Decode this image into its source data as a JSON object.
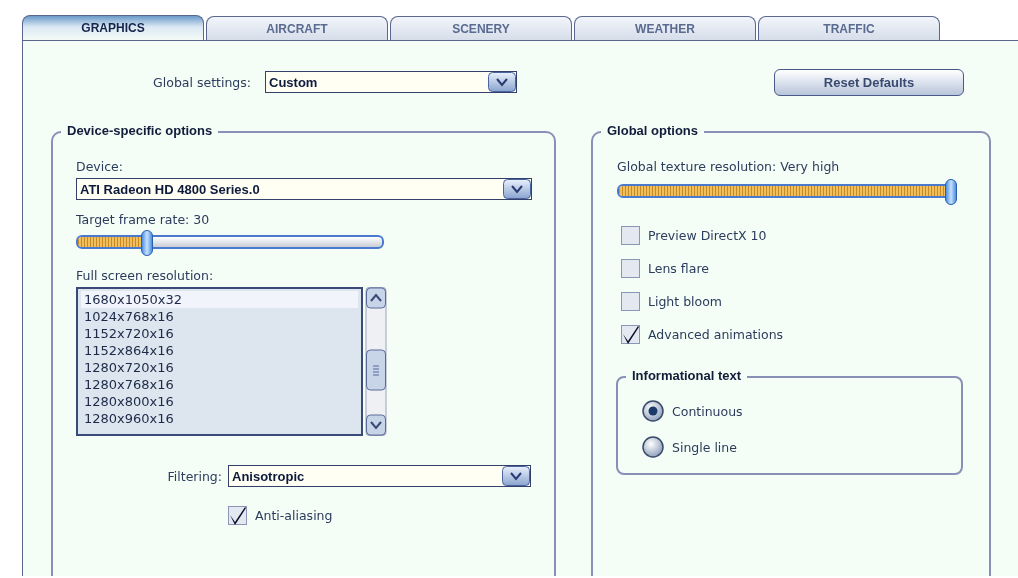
{
  "tabs": [
    {
      "label": "GRAPHICS",
      "selected": true
    },
    {
      "label": "AIRCRAFT",
      "selected": false
    },
    {
      "label": "SCENERY",
      "selected": false
    },
    {
      "label": "WEATHER",
      "selected": false
    },
    {
      "label": "TRAFFIC",
      "selected": false
    }
  ],
  "global_settings": {
    "label": "Global settings:",
    "value": "Custom"
  },
  "reset_button": "Reset Defaults",
  "device_group": {
    "title": "Device-specific options",
    "device": {
      "label": "Device:",
      "value": "ATI Radeon HD 4800 Series.0"
    },
    "frame_rate": {
      "label": "Target frame rate: 30",
      "level": 0.22
    },
    "resolution": {
      "label": "Full screen resolution:",
      "items": [
        {
          "text": "1680x1050x32",
          "selected": true
        },
        {
          "text": "1024x768x16",
          "selected": false
        },
        {
          "text": "1152x720x16",
          "selected": false
        },
        {
          "text": "1152x864x16",
          "selected": false
        },
        {
          "text": "1280x720x16",
          "selected": false
        },
        {
          "text": "1280x768x16",
          "selected": false
        },
        {
          "text": "1280x800x16",
          "selected": false
        },
        {
          "text": "1280x960x16",
          "selected": false
        }
      ]
    },
    "filtering": {
      "label": "Filtering:",
      "value": "Anisotropic"
    },
    "anti_aliasing": {
      "label": "Anti-aliasing",
      "checked": true
    }
  },
  "global_group": {
    "title": "Global options",
    "texture": {
      "label": "Global texture resolution: Very high",
      "level": 1
    },
    "options": [
      {
        "label": "Preview DirectX 10",
        "checked": false
      },
      {
        "label": "Lens flare",
        "checked": false
      },
      {
        "label": "Light bloom",
        "checked": false
      },
      {
        "label": "Advanced animations",
        "checked": true
      }
    ],
    "info_group": {
      "title": "Informational text",
      "options": [
        {
          "label": "Continuous",
          "selected": true
        },
        {
          "label": "Single line",
          "selected": false
        }
      ]
    }
  }
}
